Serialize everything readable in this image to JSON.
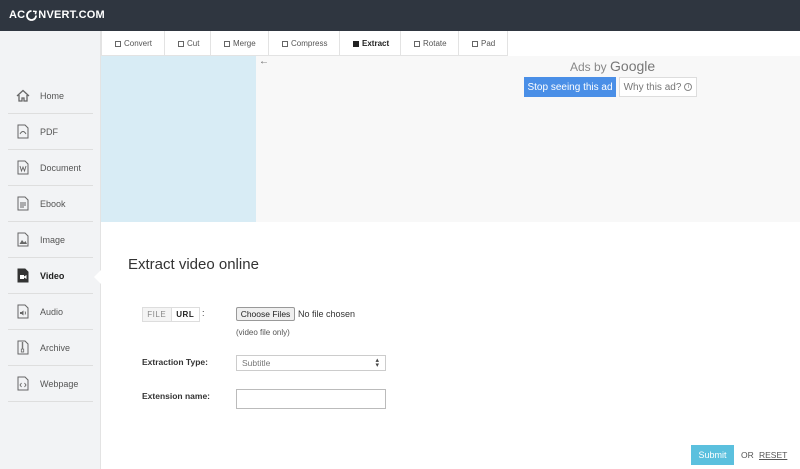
{
  "header": {
    "logo_prefix": "AC",
    "logo_suffix": "NVERT.COM"
  },
  "sidebar": {
    "items": [
      {
        "label": "Home",
        "icon": "home-icon"
      },
      {
        "label": "PDF",
        "icon": "pdf-icon"
      },
      {
        "label": "Document",
        "icon": "document-icon"
      },
      {
        "label": "Ebook",
        "icon": "ebook-icon"
      },
      {
        "label": "Image",
        "icon": "image-icon"
      },
      {
        "label": "Video",
        "icon": "video-icon",
        "active": true
      },
      {
        "label": "Audio",
        "icon": "audio-icon"
      },
      {
        "label": "Archive",
        "icon": "archive-icon"
      },
      {
        "label": "Webpage",
        "icon": "webpage-icon"
      }
    ]
  },
  "tabs": [
    {
      "label": "Convert"
    },
    {
      "label": "Cut"
    },
    {
      "label": "Merge"
    },
    {
      "label": "Compress"
    },
    {
      "label": "Extract",
      "active": true
    },
    {
      "label": "Rotate"
    },
    {
      "label": "Pad"
    }
  ],
  "ad": {
    "back_arrow": "←",
    "ads_by": "Ads by",
    "google": "Google",
    "stop_label": "Stop seeing this ad",
    "why_label": "Why this ad?",
    "info_glyph": "i"
  },
  "main": {
    "title": "Extract video online",
    "source_toggle": {
      "file": "FILE",
      "url": "URL",
      "colon": ":"
    },
    "file_input": {
      "button": "Choose Files",
      "status": "No file chosen",
      "hint": "(video file only)"
    },
    "extraction_type": {
      "label": "Extraction Type:",
      "value": "Subtitle"
    },
    "extension_name": {
      "label": "Extension name:",
      "value": ""
    },
    "submit_label": "Submit",
    "or_text": "OR",
    "reset_label": "RESET"
  },
  "colors": {
    "topbar": "#2f3640",
    "ad_blue": "#d8ecf5",
    "stop_button": "#4a8fe7",
    "submit": "#5bc0de"
  }
}
